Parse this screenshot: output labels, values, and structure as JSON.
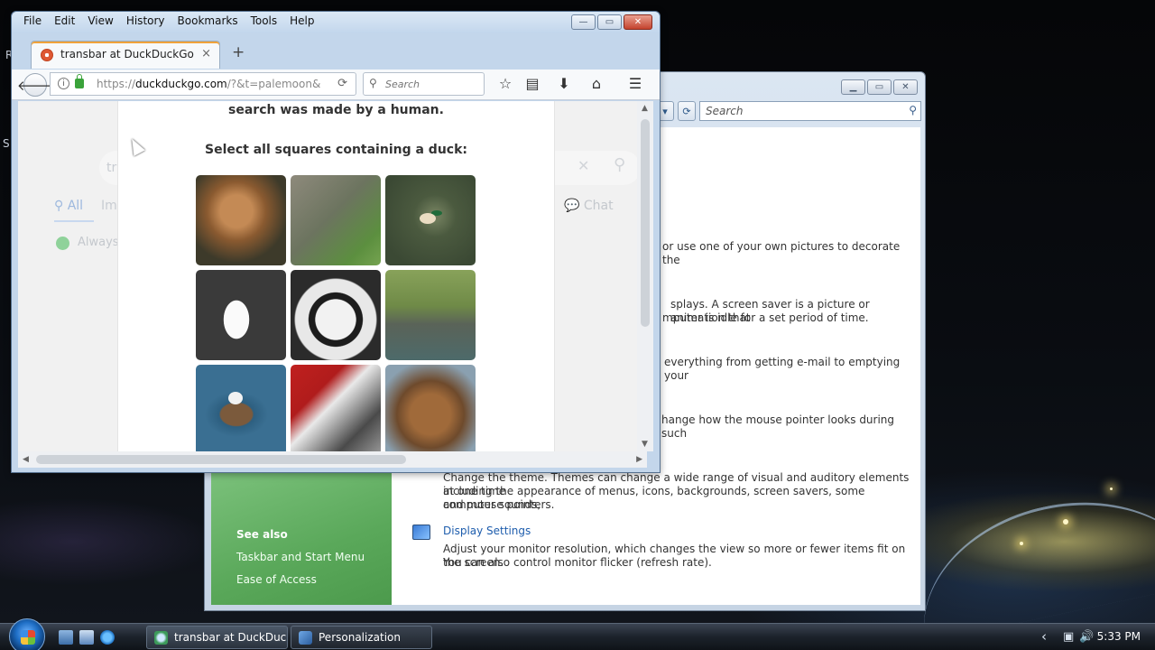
{
  "desktop": {
    "edge_letter_top": "R",
    "edge_letter_mid": "S"
  },
  "browser": {
    "menu": [
      "File",
      "Edit",
      "View",
      "History",
      "Bookmarks",
      "Tools",
      "Help"
    ],
    "window_controls": {
      "minimize": "—",
      "maximize": "▭",
      "close": "✕"
    },
    "tab": {
      "title": "transbar at DuckDuckGo",
      "close": "×"
    },
    "new_tab": "+",
    "url": {
      "scheme": "https://",
      "host": "duckduckgo.com",
      "rest": "/?&t=palemoon&"
    },
    "search_placeholder": "Search",
    "ddg_background": {
      "query": "tra",
      "tab_all": "All",
      "tab_images": "Ima",
      "chat": "Chat",
      "always": "Always"
    },
    "captcha": {
      "line1": "search was made by a human.",
      "prompt": "Select all squares containing a duck:",
      "tiles": [
        "gibbon",
        "gorilla",
        "mallard-duck",
        "white-duck",
        "panda",
        "elephant",
        "ruddy-duck",
        "husky",
        "orangutan"
      ]
    }
  },
  "control_panel": {
    "search_placeholder": "Search",
    "text_desktop_bg": "or use one of your own pictures to decorate the",
    "text_screensaver_1": "splays. A screen saver is a picture or animation that",
    "text_screensaver_2": "mputer is idle for a set period of time.",
    "text_sounds": "everything from getting e-mail to emptying your",
    "text_pointers": "hange how the mouse pointer looks during such",
    "text_theme_1": "Change the theme. Themes can change a wide range of visual and auditory elements at one time",
    "text_theme_2": "including the appearance of menus, icons, backgrounds, screen savers, some computer sounds,",
    "text_theme_3": "and mouse pointers.",
    "display_settings_link": "Display Settings",
    "display_text_1": "Adjust your monitor resolution, which changes the view so more or fewer items fit on the screen.",
    "display_text_2": "You can also control monitor flicker (refresh rate).",
    "see_also": "See also",
    "see_also_links": [
      "Taskbar and Start Menu",
      "Ease of Access"
    ]
  },
  "taskbar": {
    "buttons": [
      "transbar at DuckDuc...",
      "Personalization"
    ],
    "clock": "5:33 PM",
    "tray_arrow": "‹"
  }
}
